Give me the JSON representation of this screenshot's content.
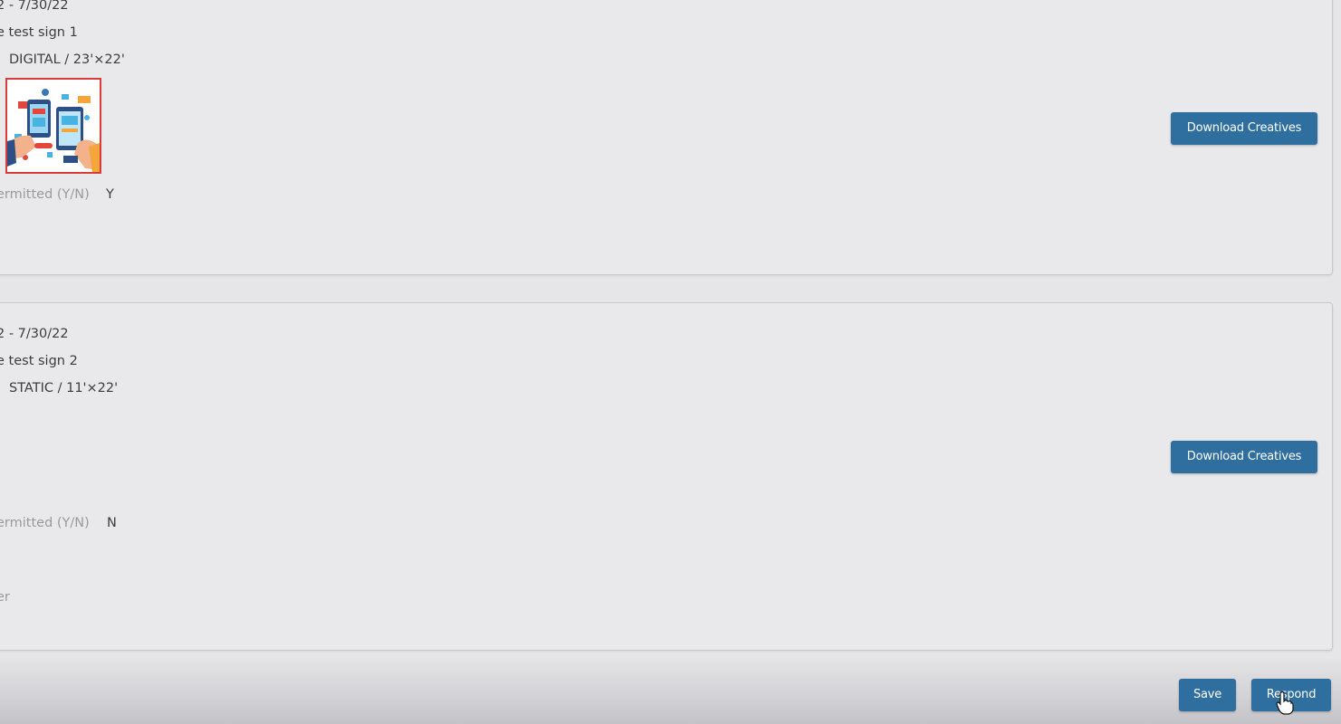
{
  "signs": [
    {
      "dates": "2 - 7/30/22",
      "name": "e test sign 1",
      "type_size": "DIGITAL / 23'×22'",
      "has_creative_thumbnail": true,
      "permitted_label": "ermitted (Y/N)",
      "permitted_value": "Y",
      "extra_rows": [
        "|"
      ],
      "download_label": "Download Creatives"
    },
    {
      "dates": "2 - 7/30/22",
      "name": "e test sign 2",
      "type_size": "STATIC / 11'×22'",
      "has_creative_thumbnail": false,
      "permitted_label": "ermitted (Y/N)",
      "permitted_value": "N",
      "extra_rows": [
        "|",
        "er"
      ],
      "download_label": "Download Creatives"
    }
  ],
  "footer": {
    "save_label": "Save",
    "respond_label": "Respond"
  },
  "colors": {
    "button": "#2e6f9f",
    "thumbnail_border": "#d93a3a",
    "card_bg": "#e9e8eb"
  },
  "icons": {
    "thumbnail": "phones-illustration",
    "cursor": "hand-pointer-icon"
  }
}
